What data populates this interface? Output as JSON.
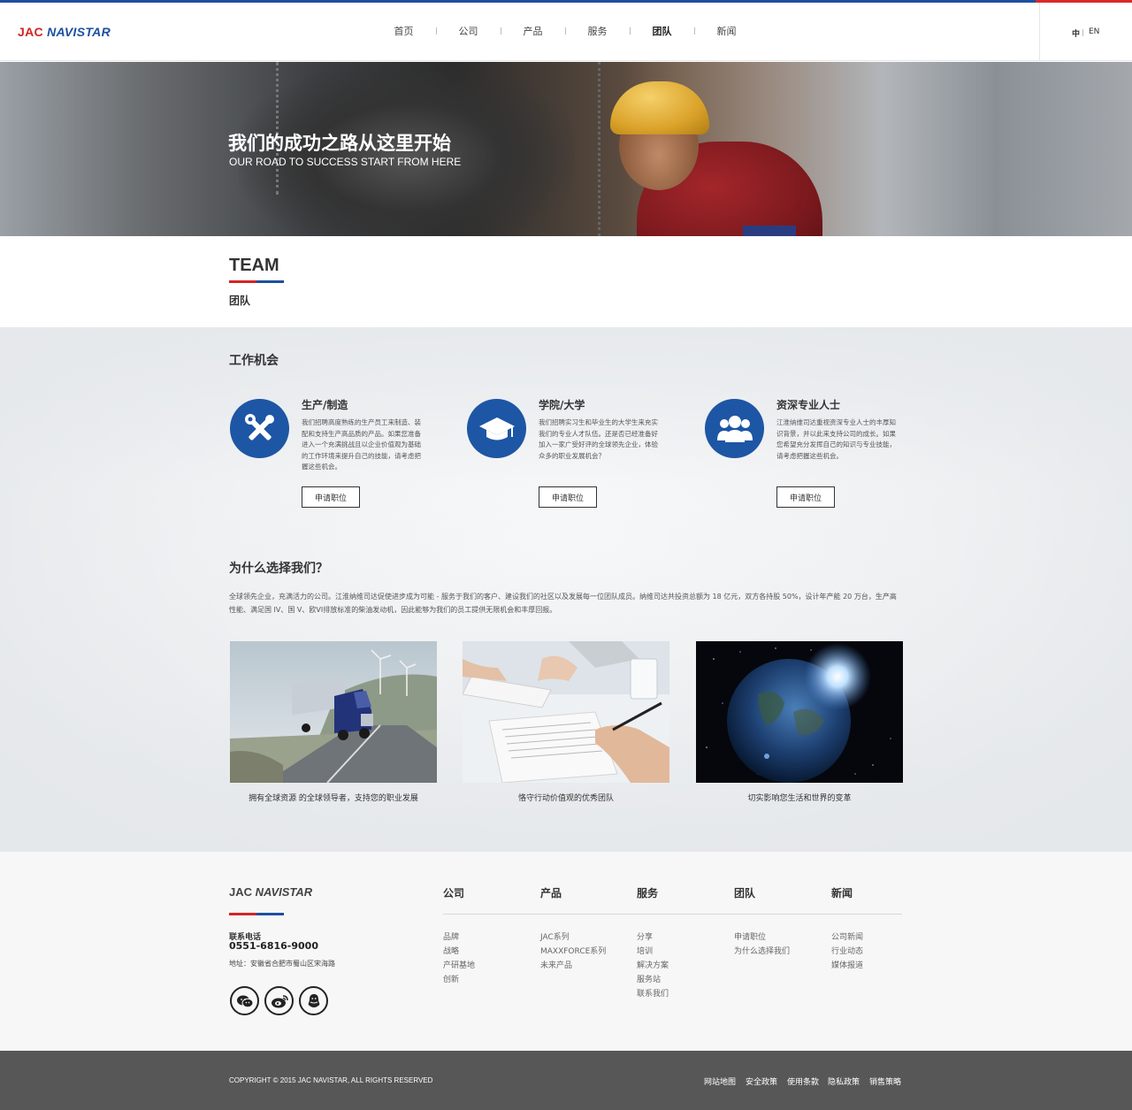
{
  "header": {
    "logo_jac": "JAC",
    "logo_navistar": "NAVISTAR",
    "nav": [
      "首页",
      "公司",
      "产品",
      "服务",
      "团队",
      "新闻"
    ],
    "active_nav": "团队",
    "lang_zh": "中",
    "lang_en": "EN"
  },
  "hero": {
    "title_cn": "我们的成功之路从这里开始",
    "title_en": "OUR ROAD TO SUCCESS START FROM HERE"
  },
  "team": {
    "title": "TEAM",
    "subtitle": "团队"
  },
  "jobs": {
    "section_title": "工作机会",
    "items": [
      {
        "icon": "tools-icon",
        "title": "生产/制造",
        "desc": "我们招聘高度熟练的生产员工来制造、装配和支持生产高品质的产品。如果您准备进入一个充满挑战且以企业价值观为基础的工作环境来提升自己的技能，请考虑把握这些机会。",
        "button": "申请职位"
      },
      {
        "icon": "graduation-cap-icon",
        "title": "学院/大学",
        "desc": "我们招聘实习生和毕业生的大学生来充实我们的专业人才队伍。还是否已经准备好加入一家广受好评的全球领先企业，体验众多的职业发展机会？",
        "button": "申请职位"
      },
      {
        "icon": "people-icon",
        "title": "资深专业人士",
        "desc": "江淮纳维司达重视资深专业人士的丰厚知识背景，并以此来支持公司的成长。如果您希望充分发挥自己的知识与专业技能，请考虑把握这些机会。",
        "button": "申请职位"
      }
    ]
  },
  "why": {
    "title": "为什么选择我们？",
    "desc": "全球领先企业，充满活力的公司。江淮纳维司达促使进步成为可能 - 服务于我们的客户、建设我们的社区以及发展每一位团队成员。纳维司达共投资总额为 18 亿元，双方各持股 50%，设计年产能 20 万台，生产高性能、满足国 IV、国 V、欧VI排放标准的柴油发动机，因此能够为我们的员工提供无限机会和丰厚回报。",
    "cards": [
      {
        "caption": "拥有全球资源 的全球领导者，支持您的职业发展"
      },
      {
        "caption": "恪守行动价值观的优秀团队"
      },
      {
        "caption": "切实影响您生活和世界的变革"
      }
    ]
  },
  "footer": {
    "logo_jac": "JAC",
    "logo_navistar": "NAVISTAR",
    "phone_label": "联系电话",
    "phone": "0551-6816-9000",
    "address": "地址：安徽省合肥市蜀山区宋海路",
    "social": [
      "wechat-icon",
      "weibo-icon",
      "qq-icon"
    ],
    "columns": [
      {
        "title": "公司",
        "links": [
          "品牌",
          "战略",
          "产研基地",
          "创新"
        ]
      },
      {
        "title": "产品",
        "links": [
          "JAC系列",
          "MAXXFORCE系列",
          "未来产品"
        ]
      },
      {
        "title": "服务",
        "links": [
          "分享",
          "培训",
          "解决方案",
          "服务站",
          "联系我们"
        ]
      },
      {
        "title": "团队",
        "links": [
          "申请职位",
          "为什么选择我们"
        ]
      },
      {
        "title": "新闻",
        "links": [
          "公司新闻",
          "行业动态",
          "媒体报道"
        ]
      }
    ]
  },
  "bottom": {
    "copyright": "COPYRIGHT © 2015 JAC NAVISTAR, ALL RIGHTS RESERVED",
    "links": [
      "网站地图",
      "安全政策",
      "使用条款",
      "隐私政策",
      "销售策略"
    ]
  },
  "colors": {
    "brand_blue": "#1d56a4",
    "brand_red": "#d32424",
    "bottom_bar": "#575757"
  }
}
